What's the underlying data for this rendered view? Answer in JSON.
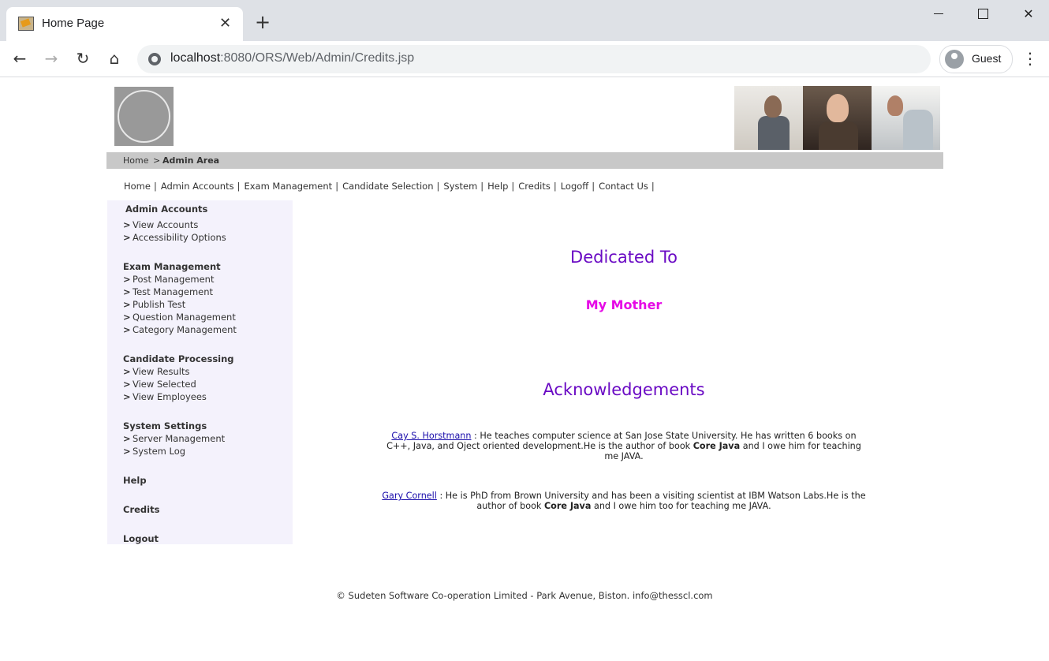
{
  "browser": {
    "tab_title": "Home Page",
    "tab_close": "✕",
    "new_tab": "+",
    "url_host": "localhost",
    "url_path": ":8080/ORS/Web/Admin/Credits.jsp",
    "profile_label": "Guest",
    "nav": {
      "back": "←",
      "forward": "→",
      "reload": "↻",
      "home": "⌂"
    },
    "menu": "⋮",
    "window": {
      "close": "✕"
    }
  },
  "breadcrumb": {
    "home": "Home",
    "sep": ">",
    "current": "Admin Area"
  },
  "topnav": [
    "Home",
    "Admin Accounts",
    "Exam Management",
    "Candidate Selection",
    "System",
    "Help",
    "Credits",
    "Logoff",
    "Contact Us"
  ],
  "topnav_sep": "|",
  "sidebar": {
    "chevron": ">",
    "admin_accounts": {
      "title": "Admin Accounts",
      "items": [
        "View Accounts",
        "Accessibility Options"
      ]
    },
    "exam_management": {
      "title": "Exam Management",
      "items": [
        "Post Management",
        "Test Management",
        "Publish Test",
        "Question Management",
        "Category Management"
      ]
    },
    "candidate_processing": {
      "title": "Candidate Processing",
      "items": [
        "View Results",
        "View Selected",
        "View Employees"
      ]
    },
    "system_settings": {
      "title": "System Settings",
      "items": [
        "Server Management",
        "System Log"
      ]
    },
    "help": "Help",
    "credits": "Credits",
    "logout": "Logout"
  },
  "content": {
    "dedicated_to": "Dedicated To",
    "dedicatee": "My Mother",
    "ack_title": "Acknowledgements",
    "ack1": {
      "name": "Cay S. Horstmann",
      "text_a": " : He teaches computer science at San Jose State University. He has written 6 books on C++, Java, and Oject oriented development.He is the author of book ",
      "book": "Core Java",
      "text_b": " and I owe him for teaching me JAVA."
    },
    "ack2": {
      "name": "Gary Cornell",
      "text_a": " : He is PhD from Brown University and has been a visiting scientist at IBM Watson Labs.He is the author of book ",
      "book": "Core Java",
      "text_b": " and I owe him too for teaching me JAVA."
    }
  },
  "footer": "© Sudeten Software Co-operation Limited - Park Avenue, Biston. info@thesscl.com",
  "colors": {
    "heading": "#6a0ac4",
    "dedicatee": "#e60ae6",
    "sidebar_bg": "#f4f2fc",
    "crumbbar": "#c8c8c8"
  }
}
